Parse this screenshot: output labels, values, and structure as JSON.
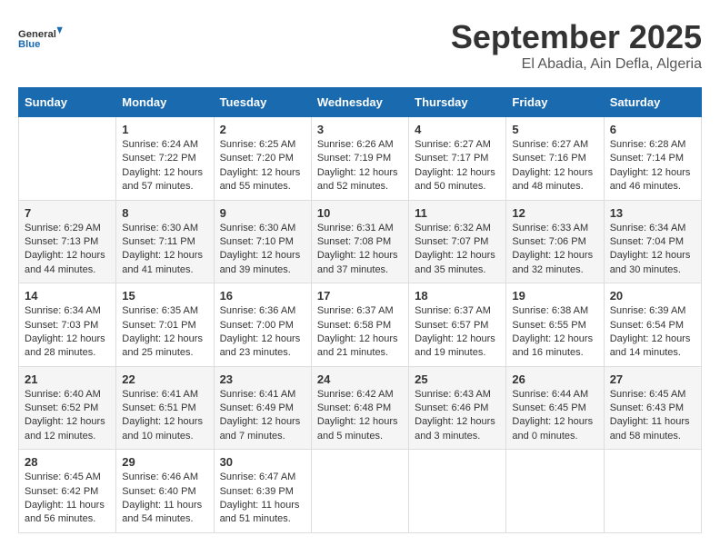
{
  "header": {
    "logo_general": "General",
    "logo_blue": "Blue",
    "month_title": "September 2025",
    "location": "El Abadia, Ain Defla, Algeria"
  },
  "days_of_week": [
    "Sunday",
    "Monday",
    "Tuesday",
    "Wednesday",
    "Thursday",
    "Friday",
    "Saturday"
  ],
  "weeks": [
    [
      {
        "day": "",
        "content": ""
      },
      {
        "day": "1",
        "content": "Sunrise: 6:24 AM\nSunset: 7:22 PM\nDaylight: 12 hours\nand 57 minutes."
      },
      {
        "day": "2",
        "content": "Sunrise: 6:25 AM\nSunset: 7:20 PM\nDaylight: 12 hours\nand 55 minutes."
      },
      {
        "day": "3",
        "content": "Sunrise: 6:26 AM\nSunset: 7:19 PM\nDaylight: 12 hours\nand 52 minutes."
      },
      {
        "day": "4",
        "content": "Sunrise: 6:27 AM\nSunset: 7:17 PM\nDaylight: 12 hours\nand 50 minutes."
      },
      {
        "day": "5",
        "content": "Sunrise: 6:27 AM\nSunset: 7:16 PM\nDaylight: 12 hours\nand 48 minutes."
      },
      {
        "day": "6",
        "content": "Sunrise: 6:28 AM\nSunset: 7:14 PM\nDaylight: 12 hours\nand 46 minutes."
      }
    ],
    [
      {
        "day": "7",
        "content": "Sunrise: 6:29 AM\nSunset: 7:13 PM\nDaylight: 12 hours\nand 44 minutes."
      },
      {
        "day": "8",
        "content": "Sunrise: 6:30 AM\nSunset: 7:11 PM\nDaylight: 12 hours\nand 41 minutes."
      },
      {
        "day": "9",
        "content": "Sunrise: 6:30 AM\nSunset: 7:10 PM\nDaylight: 12 hours\nand 39 minutes."
      },
      {
        "day": "10",
        "content": "Sunrise: 6:31 AM\nSunset: 7:08 PM\nDaylight: 12 hours\nand 37 minutes."
      },
      {
        "day": "11",
        "content": "Sunrise: 6:32 AM\nSunset: 7:07 PM\nDaylight: 12 hours\nand 35 minutes."
      },
      {
        "day": "12",
        "content": "Sunrise: 6:33 AM\nSunset: 7:06 PM\nDaylight: 12 hours\nand 32 minutes."
      },
      {
        "day": "13",
        "content": "Sunrise: 6:34 AM\nSunset: 7:04 PM\nDaylight: 12 hours\nand 30 minutes."
      }
    ],
    [
      {
        "day": "14",
        "content": "Sunrise: 6:34 AM\nSunset: 7:03 PM\nDaylight: 12 hours\nand 28 minutes."
      },
      {
        "day": "15",
        "content": "Sunrise: 6:35 AM\nSunset: 7:01 PM\nDaylight: 12 hours\nand 25 minutes."
      },
      {
        "day": "16",
        "content": "Sunrise: 6:36 AM\nSunset: 7:00 PM\nDaylight: 12 hours\nand 23 minutes."
      },
      {
        "day": "17",
        "content": "Sunrise: 6:37 AM\nSunset: 6:58 PM\nDaylight: 12 hours\nand 21 minutes."
      },
      {
        "day": "18",
        "content": "Sunrise: 6:37 AM\nSunset: 6:57 PM\nDaylight: 12 hours\nand 19 minutes."
      },
      {
        "day": "19",
        "content": "Sunrise: 6:38 AM\nSunset: 6:55 PM\nDaylight: 12 hours\nand 16 minutes."
      },
      {
        "day": "20",
        "content": "Sunrise: 6:39 AM\nSunset: 6:54 PM\nDaylight: 12 hours\nand 14 minutes."
      }
    ],
    [
      {
        "day": "21",
        "content": "Sunrise: 6:40 AM\nSunset: 6:52 PM\nDaylight: 12 hours\nand 12 minutes."
      },
      {
        "day": "22",
        "content": "Sunrise: 6:41 AM\nSunset: 6:51 PM\nDaylight: 12 hours\nand 10 minutes."
      },
      {
        "day": "23",
        "content": "Sunrise: 6:41 AM\nSunset: 6:49 PM\nDaylight: 12 hours\nand 7 minutes."
      },
      {
        "day": "24",
        "content": "Sunrise: 6:42 AM\nSunset: 6:48 PM\nDaylight: 12 hours\nand 5 minutes."
      },
      {
        "day": "25",
        "content": "Sunrise: 6:43 AM\nSunset: 6:46 PM\nDaylight: 12 hours\nand 3 minutes."
      },
      {
        "day": "26",
        "content": "Sunrise: 6:44 AM\nSunset: 6:45 PM\nDaylight: 12 hours\nand 0 minutes."
      },
      {
        "day": "27",
        "content": "Sunrise: 6:45 AM\nSunset: 6:43 PM\nDaylight: 11 hours\nand 58 minutes."
      }
    ],
    [
      {
        "day": "28",
        "content": "Sunrise: 6:45 AM\nSunset: 6:42 PM\nDaylight: 11 hours\nand 56 minutes."
      },
      {
        "day": "29",
        "content": "Sunrise: 6:46 AM\nSunset: 6:40 PM\nDaylight: 11 hours\nand 54 minutes."
      },
      {
        "day": "30",
        "content": "Sunrise: 6:47 AM\nSunset: 6:39 PM\nDaylight: 11 hours\nand 51 minutes."
      },
      {
        "day": "",
        "content": ""
      },
      {
        "day": "",
        "content": ""
      },
      {
        "day": "",
        "content": ""
      },
      {
        "day": "",
        "content": ""
      }
    ]
  ]
}
